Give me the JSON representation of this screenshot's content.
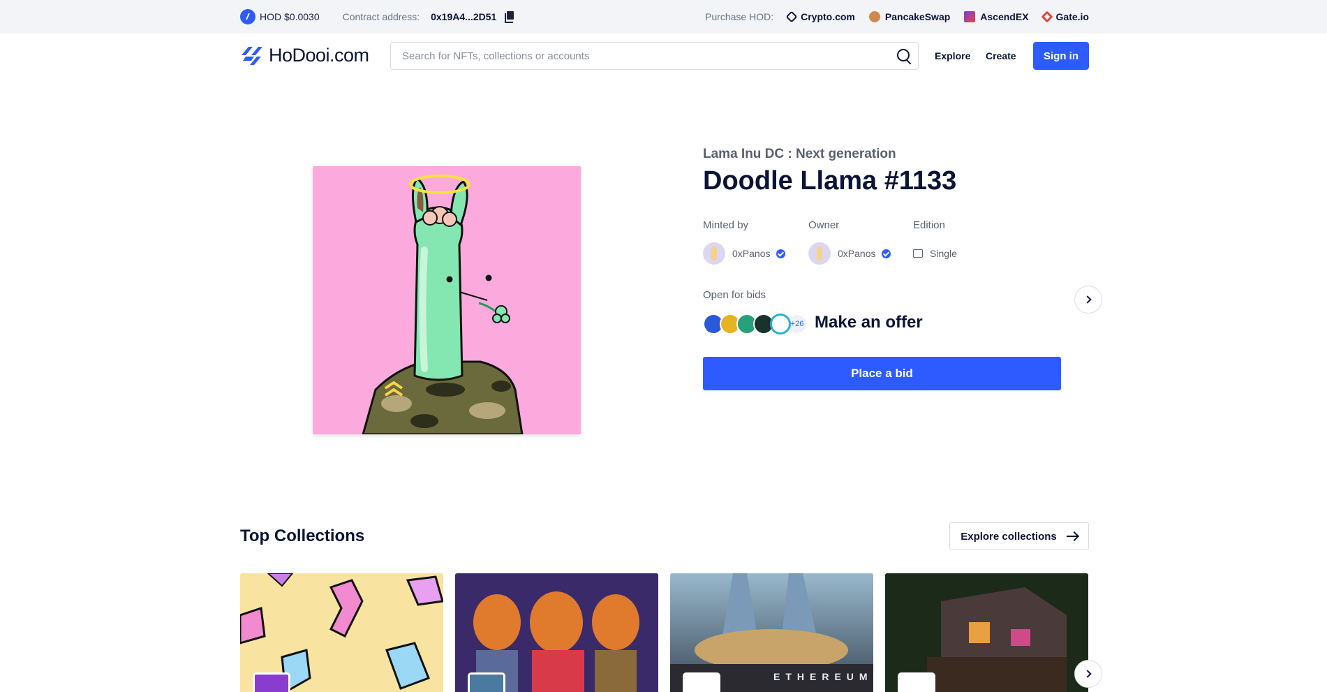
{
  "topbar": {
    "hod_price": "HOD $0.0030",
    "contract_label": "Contract address:",
    "contract_value": "0x19A4...2D51",
    "purchase_label": "Purchase HOD:",
    "exchanges": [
      {
        "name": "Crypto.com",
        "icon": "crypto-com-icon",
        "color": "#0b1437"
      },
      {
        "name": "PancakeSwap",
        "icon": "pancakeswap-icon",
        "color": "#d1884f"
      },
      {
        "name": "AscendEX",
        "icon": "ascendex-icon",
        "color": "#7b3fe4"
      },
      {
        "name": "Gate.io",
        "icon": "gate-io-icon",
        "color": "#e2473b"
      }
    ]
  },
  "header": {
    "logo_text": "HoDooi.com",
    "search_placeholder": "Search for NFTs, collections or accounts",
    "nav": {
      "explore": "Explore",
      "create": "Create"
    },
    "signin_label": "Sign in"
  },
  "nft": {
    "collection": "Lama Inu DC : Next generation",
    "title": "Doodle Llama #1133",
    "minted_by_label": "Minted by",
    "minted_by": "0xPanos",
    "owner_label": "Owner",
    "owner": "0xPanos",
    "edition_label": "Edition",
    "edition": "Single",
    "open_for_bids_label": "Open for bids",
    "more_tokens": "+26",
    "make_offer": "Make an offer",
    "place_bid_label": "Place a bid"
  },
  "top_collections": {
    "title": "Top Collections",
    "explore_label": "Explore collections"
  },
  "colors": {
    "brand_blue": "#2d5bff",
    "nft_background": "#fcaadd",
    "text_dark": "#0b1437",
    "text_muted": "#5b6070"
  }
}
